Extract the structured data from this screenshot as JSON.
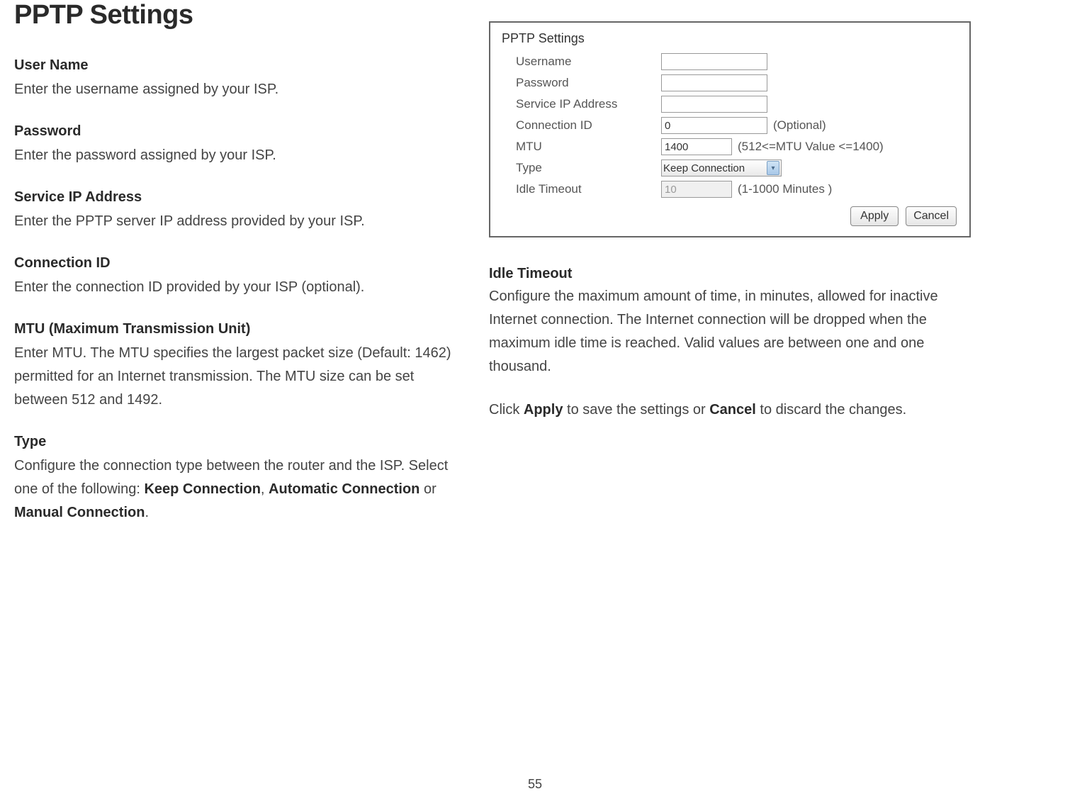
{
  "pageTitle": "PPTP Settings",
  "left": {
    "username": {
      "title": "User Name",
      "body": "Enter the username assigned by your ISP."
    },
    "password": {
      "title": "Password",
      "body": "Enter the password assigned by your ISP."
    },
    "serviceIp": {
      "title": "Service IP Address",
      "body": "Enter the PPTP server IP address provided by your ISP."
    },
    "connId": {
      "title": "Connection ID",
      "body": "Enter the connection ID provided by your ISP (optional)."
    },
    "mtu": {
      "title": "MTU (Maximum Transmission Unit)",
      "body": "Enter MTU. The MTU specifies the largest packet size (Default: 1462) permitted for an Internet transmission. The MTU size can be set between 512 and 1492."
    },
    "type": {
      "title": "Type",
      "body_prefix": "Configure the connection type between the router and the ISP. Select one of the following: ",
      "opt1": "Keep Connection",
      "sep12": ", ",
      "opt2": "Automatic Connection",
      "sep23": " or ",
      "opt3": "Manual Connection",
      "suffix": "."
    }
  },
  "right": {
    "idle": {
      "title": "Idle Timeout",
      "body": "Configure the maximum amount of time, in minutes, allowed for inactive Internet connection. The Internet connection will be dropped when the maximum idle time is reached. Valid values are between one and one thousand."
    },
    "apply_prefix": "Click ",
    "apply_bold1": "Apply",
    "apply_mid": " to save the settings or ",
    "apply_bold2": "Cancel",
    "apply_suffix": " to discard the changes."
  },
  "panel": {
    "title": "PPTP Settings",
    "labels": {
      "username": "Username",
      "password": "Password",
      "serviceIp": "Service IP Address",
      "connId": "Connection ID",
      "mtu": "MTU",
      "type": "Type",
      "idle": "Idle Timeout"
    },
    "values": {
      "username": "",
      "password": "",
      "serviceIp": "",
      "connId": "0",
      "mtu": "1400",
      "type": "Keep Connection",
      "idle": "10"
    },
    "hints": {
      "connId": "(Optional)",
      "mtu": "(512<=MTU Value <=1400)",
      "idle": "(1-1000 Minutes )"
    },
    "buttons": {
      "apply": "Apply",
      "cancel": "Cancel"
    }
  },
  "pageNumber": "55"
}
